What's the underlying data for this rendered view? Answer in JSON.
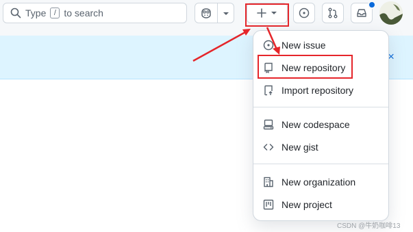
{
  "header": {
    "search": {
      "prefix": "Type",
      "key": "/",
      "suffix": "to search"
    }
  },
  "menu": {
    "items": [
      {
        "label": "New issue",
        "icon": "issue-opened-icon"
      },
      {
        "label": "New repository",
        "icon": "repo-icon"
      },
      {
        "label": "Import repository",
        "icon": "repo-push-icon"
      },
      {
        "label": "New codespace",
        "icon": "codespaces-icon"
      },
      {
        "label": "New gist",
        "icon": "code-icon"
      },
      {
        "label": "New organization",
        "icon": "organization-icon"
      },
      {
        "label": "New project",
        "icon": "project-icon"
      }
    ]
  },
  "banner": {
    "close": "×"
  },
  "watermark": "CSDN @牛奶咖啡13",
  "colors": {
    "highlight": "#e5252a",
    "banner": "#ddf4ff",
    "accent": "#0969da"
  }
}
